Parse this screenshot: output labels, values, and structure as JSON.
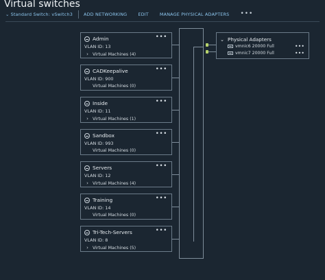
{
  "page": {
    "title": "Virtual switches"
  },
  "toolbar": {
    "switch_label": "Standard Switch: vSwitch3",
    "actions": [
      "ADD NETWORKING",
      "EDIT",
      "MANAGE PHYSICAL ADAPTERS"
    ],
    "more": "•••"
  },
  "port_groups": [
    {
      "name": "Admin",
      "vlan": "VLAN ID: 13",
      "vms": "Virtual Machines (4)",
      "expandable": true
    },
    {
      "name": "CADKeepalive",
      "vlan": "VLAN ID: 900",
      "vms": "Virtual Machines (0)",
      "expandable": false
    },
    {
      "name": "Inside",
      "vlan": "VLAN ID: 11",
      "vms": "Virtual Machines (1)",
      "expandable": true
    },
    {
      "name": "Sandbox",
      "vlan": "VLAN ID: 993",
      "vms": "Virtual Machines (0)",
      "expandable": false
    },
    {
      "name": "Servers",
      "vlan": "VLAN ID: 12",
      "vms": "Virtual Machines (4)",
      "expandable": true
    },
    {
      "name": "Training",
      "vlan": "VLAN ID: 14",
      "vms": "Virtual Machines (0)",
      "expandable": false
    },
    {
      "name": "Tri-Tech-Servers",
      "vlan": "VLAN ID: 8",
      "vms": "Virtual Machines (5)",
      "expandable": true
    }
  ],
  "physical_adapters": {
    "title": "Physical Adapters",
    "items": [
      {
        "label": "vmnic6 20000 Full"
      },
      {
        "label": "vmnic7 20000 Full"
      }
    ]
  },
  "dots_label": "•••",
  "colors": {
    "accent": "#8ec7ef",
    "link_up": "#b7d36b",
    "background": "#1b2631"
  },
  "icons": {
    "port_group": "network-globe-icon",
    "nic": "network-adapter-icon",
    "expand": "chevron-right-icon",
    "collapse": "chevron-down-icon"
  }
}
